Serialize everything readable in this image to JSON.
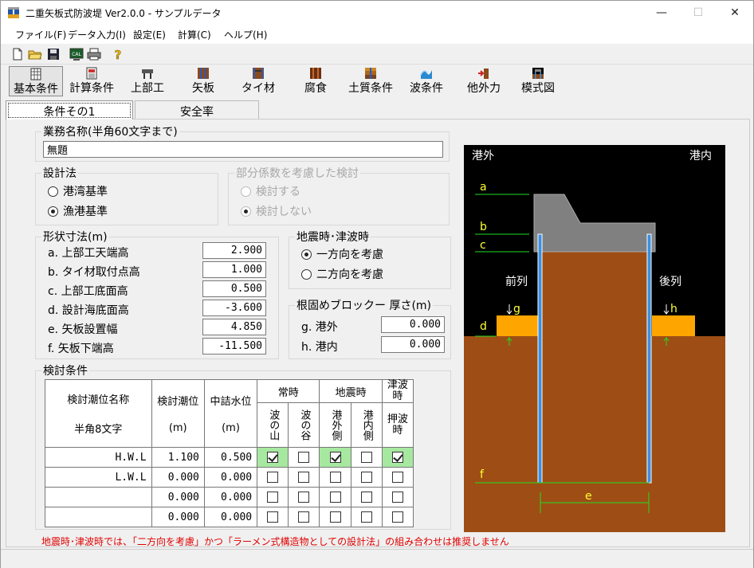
{
  "window": {
    "title": "二重矢板式防波堤 Ver2.0.0 - サンプルデータ",
    "minimize": "—",
    "maximize": "☐",
    "close": "✕"
  },
  "menu": [
    "ファイル(F)",
    "データ入力(I)",
    "設定(E)",
    "計算(C)",
    "ヘルプ(H)"
  ],
  "toolbar_buttons": [
    "基本条件",
    "計算条件",
    "上部工",
    "矢板",
    "タイ材",
    "腐食",
    "土質条件",
    "波条件",
    "他外力",
    "模式図"
  ],
  "tabs": [
    "条件その1",
    "安全率"
  ],
  "job_name": {
    "label": "業務名称(半角60文字まで)",
    "value": "無題"
  },
  "design_method": {
    "label": "設計法",
    "options": [
      "港湾基準",
      "漁港基準"
    ],
    "selected": "漁港基準"
  },
  "partial_factor": {
    "label": "部分係数を考慮した検討",
    "options": [
      "検討する",
      "検討しない"
    ],
    "selected": "検討しない"
  },
  "dimensions": {
    "label": "形状寸法(m)",
    "rows": [
      {
        "label": "a. 上部工天端高",
        "value": "2.900"
      },
      {
        "label": "b. タイ材取付点高",
        "value": "1.000"
      },
      {
        "label": "c. 上部工底面高",
        "value": "0.500"
      },
      {
        "label": "d. 設計海底面高",
        "value": "-3.600"
      },
      {
        "label": "e. 矢板設置幅",
        "value": "4.850"
      },
      {
        "label": "f. 矢板下端高",
        "value": "-11.500"
      }
    ]
  },
  "seismic": {
    "label": "地震時･津波時",
    "options": [
      "一方向を考慮",
      "二方向を考慮"
    ],
    "selected": "一方向を考慮"
  },
  "root_block": {
    "label": "根固めブロックー 厚さ(m)",
    "rows": [
      {
        "label": "g. 港外",
        "value": "0.000"
      },
      {
        "label": "h. 港内",
        "value": "0.000"
      }
    ]
  },
  "check_conditions": {
    "label": "検討条件",
    "headers": {
      "name": "検討潮位名称",
      "name_sub": "半角8文字",
      "tide": "検討潮位",
      "tide_unit": "(m)",
      "inner": "中詰水位",
      "inner_unit": "(m)",
      "normal": "常時",
      "normal_crest": "波の山",
      "normal_trough": "波の谷",
      "seismic": "地震時",
      "seismic_out": "港外側",
      "seismic_in": "港内側",
      "tsunami": "津波時",
      "tsunami_push": "押波時"
    },
    "rows": [
      {
        "name": "H.W.L",
        "tide": "1.100",
        "inner": "0.500",
        "checks": [
          true,
          false,
          true,
          false,
          true
        ],
        "highlight": true
      },
      {
        "name": "L.W.L",
        "tide": "0.000",
        "inner": "0.000",
        "checks": [
          false,
          false,
          false,
          false,
          false
        ],
        "highlight": false
      },
      {
        "name": "",
        "tide": "0.000",
        "inner": "0.000",
        "checks": [
          false,
          false,
          false,
          false,
          false
        ],
        "highlight": false
      },
      {
        "name": "",
        "tide": "0.000",
        "inner": "0.000",
        "checks": [
          false,
          false,
          false,
          false,
          false
        ],
        "highlight": false
      }
    ]
  },
  "warning": "地震時･津波時では、「二方向を考慮」かつ「ラーメン式構造物としての設計法」の組み合わせは推奨しません",
  "diagram": {
    "outside": "港外",
    "inside": "港内",
    "front": "前列",
    "back": "後列",
    "labels": [
      "a",
      "b",
      "c",
      "d",
      "e",
      "f",
      "g",
      "h"
    ],
    "colors": {
      "background": "#000000",
      "soil": "#9e4e14",
      "block": "#ffa500",
      "crown": "#808080",
      "pile": "#3b8fe0",
      "line": "#22dd22",
      "label": "#ffff33"
    }
  }
}
